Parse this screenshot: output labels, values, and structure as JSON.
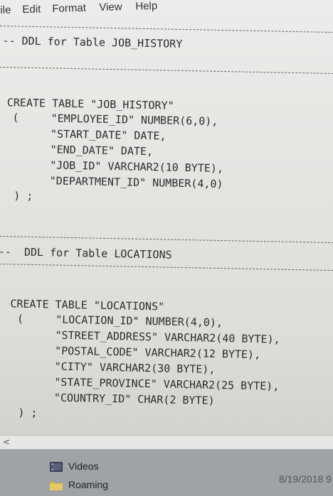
{
  "menu": {
    "file_partial": "ile",
    "edit": "Edit",
    "format": "Format",
    "view": "View",
    "help": "Help"
  },
  "editor": {
    "job_history": {
      "comment": "-- DDL for Table JOB_HISTORY",
      "create": "CREATE TABLE \"JOB_HISTORY\"",
      "col1": "(     \"EMPLOYEE_ID\" NUMBER(6,0),",
      "col2": "\"START_DATE\" DATE,",
      "col3": "\"END_DATE\" DATE,",
      "col4": "\"JOB_ID\" VARCHAR2(10 BYTE),",
      "col5": "\"DEPARTMENT_ID\" NUMBER(4,0)",
      "close": ") ;"
    },
    "locations": {
      "comment": "--  DDL for Table LOCATIONS",
      "create": "CREATE TABLE \"LOCATIONS\"",
      "col1": "(     \"LOCATION_ID\" NUMBER(4,0),",
      "col2": "\"STREET_ADDRESS\" VARCHAR2(40 BYTE),",
      "col3": "\"POSTAL_CODE\" VARCHAR2(12 BYTE),",
      "col4": "\"CITY\" VARCHAR2(30 BYTE),",
      "col5": "\"STATE_PROVINCE\" VARCHAR2(25 BYTE),",
      "col6": "\"COUNTRY_ID\" CHAR(2 BYTE)",
      "close": ") ;"
    }
  },
  "scrollbar": {
    "left_arrow": "<"
  },
  "explorer": {
    "items": [
      {
        "label": "Videos",
        "icon": "video-folder-icon"
      },
      {
        "label": "Roaming",
        "icon": "folder-icon"
      }
    ],
    "date": "8/19/2018 9"
  }
}
